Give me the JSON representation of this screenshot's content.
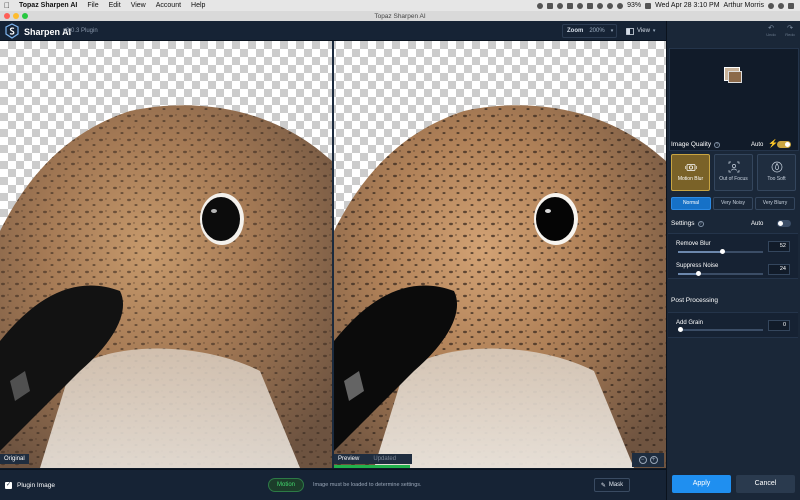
{
  "menubar": {
    "app": "Topaz Sharpen AI",
    "items": [
      "File",
      "Edit",
      "View",
      "Account",
      "Help"
    ],
    "battery": "93%",
    "datetime": "Wed Apr 28  3:10 PM",
    "user": "Arthur Morris"
  },
  "window": {
    "title": "Topaz Sharpen AI"
  },
  "toolbar": {
    "app_name": "Sharpen AI",
    "version": "v3.0.3 Plugin",
    "zoom_label": "Zoom",
    "zoom_value": "200%",
    "view_label": "View"
  },
  "canvas": {
    "original_label": "Original",
    "preview_label": "Preview",
    "updated_label": "Updated",
    "progress": 1.0
  },
  "statusbar": {
    "plugin_image_label": "Plugin Image",
    "plugin_image_checked": true,
    "model_pill": "Motion",
    "message": "Image must be loaded to determine settings.",
    "mask_label": "Mask"
  },
  "panel": {
    "undo_label": "Undo",
    "redo_label": "Redo",
    "image_quality_label": "Image Quality",
    "auto_label": "Auto",
    "image_quality_auto": true,
    "modes": [
      {
        "label": "Motion Blur",
        "icon": "camera-shake-icon",
        "active": true
      },
      {
        "label": "Out of Focus",
        "icon": "focus-person-icon",
        "active": false
      },
      {
        "label": "Too Soft",
        "icon": "soft-drop-icon",
        "active": false
      }
    ],
    "noise_levels": [
      {
        "label": "Normal",
        "active": true
      },
      {
        "label": "Very Noisy",
        "active": false
      },
      {
        "label": "Very Blurry",
        "active": false
      }
    ],
    "settings_label": "Settings",
    "settings_auto": false,
    "remove_blur": {
      "label": "Remove Blur",
      "value": "52",
      "fraction": 0.52
    },
    "suppress_noise": {
      "label": "Suppress Noise",
      "value": "24",
      "fraction": 0.24
    },
    "post_processing_label": "Post Processing",
    "add_grain": {
      "label": "Add Grain",
      "value": "0",
      "fraction": 0.0
    },
    "apply_label": "Apply",
    "cancel_label": "Cancel"
  },
  "colors": {
    "accent": "#1f8ff0",
    "gold": "#c9a542",
    "green": "#22b14c",
    "panel_bg": "#1a2738"
  }
}
